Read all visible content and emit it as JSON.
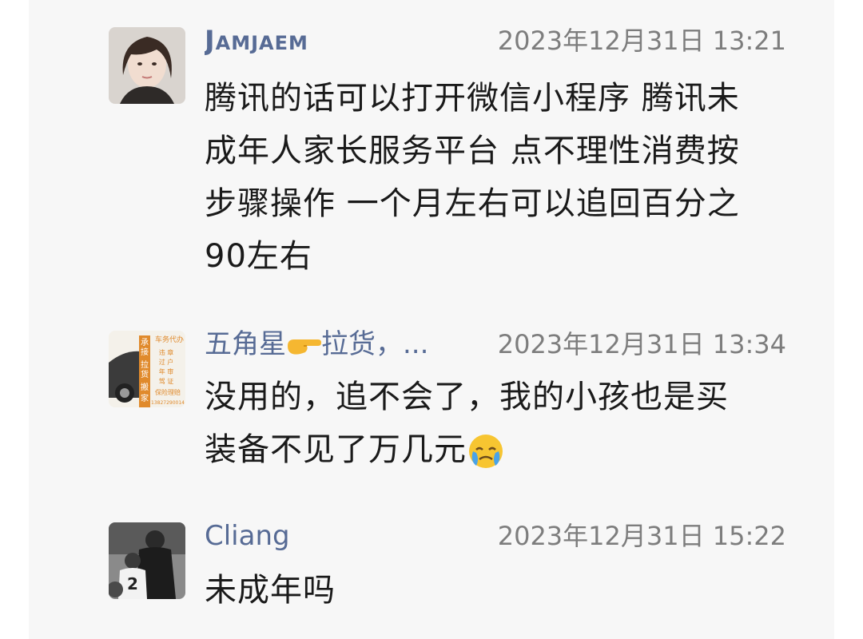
{
  "comments": [
    {
      "author": "Jamjaem",
      "time": "2023年12月31日 13:21",
      "lines": [
        "腾讯的话可以打开微信小程序 腾讯未",
        "成年人家长服务平台 点不理性消费按",
        "步骤操作 一个月左右可以追回百分之",
        "90左右"
      ]
    },
    {
      "author_prefix": "五角星",
      "author_icon": "pointing-hand-icon",
      "author_suffix": "拉货，...",
      "time": "2023年12月31日 13:34",
      "lines": [
        "没用的，追不会了，我的小孩也是买",
        "装备不见了万几元"
      ],
      "trailing_icon": "crying-emoji-icon",
      "avatar_text": {
        "right_top": "车务代办",
        "right_list": [
          "违  章",
          "过  户",
          "年  审",
          "驾  证"
        ],
        "right_bottom": "保险理赔",
        "left_vertical": [
          "承",
          "接",
          "拉",
          "货",
          "搬",
          "家"
        ],
        "phone": "13827290014"
      }
    },
    {
      "author": "Cliang",
      "time": "2023年12月31日 15:22",
      "lines": [
        "未成年吗"
      ]
    }
  ],
  "colors": {
    "author": "#576b95",
    "timestamp": "#7d7d7d",
    "text": "#1a1a1a",
    "panel": "#f7f7f7"
  }
}
